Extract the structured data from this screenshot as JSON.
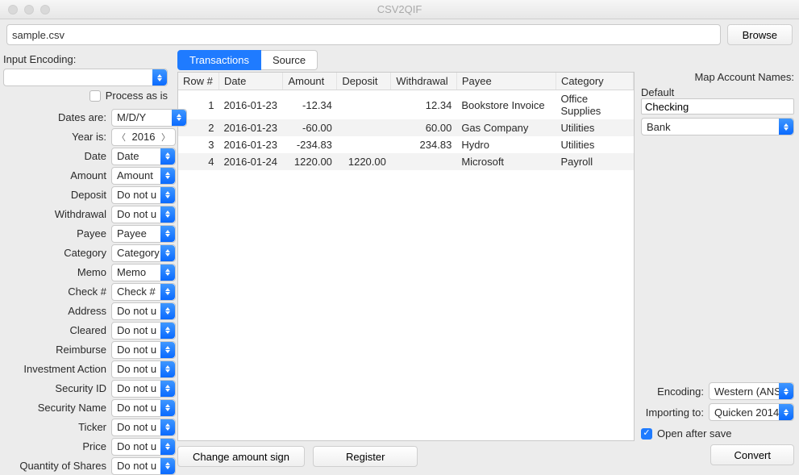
{
  "app": {
    "title": "CSV2QIF"
  },
  "header": {
    "file_value": "sample.csv",
    "browse_label": "Browse"
  },
  "left": {
    "input_encoding_label": "Input Encoding:",
    "input_encoding_value": "",
    "process_as_is_label": "Process as is",
    "dates_are_label": "Dates are:",
    "dates_are_value": "M/D/Y",
    "year_is_label": "Year is:",
    "year_value": "2016",
    "fields": [
      {
        "label": "Date",
        "value": "Date"
      },
      {
        "label": "Amount",
        "value": "Amount"
      },
      {
        "label": "Deposit",
        "value": "Do not u"
      },
      {
        "label": "Withdrawal",
        "value": "Do not u"
      },
      {
        "label": "Payee",
        "value": "Payee"
      },
      {
        "label": "Category",
        "value": "Category"
      },
      {
        "label": "Memo",
        "value": "Memo"
      },
      {
        "label": "Check #",
        "value": "Check #"
      },
      {
        "label": "Address",
        "value": "Do not u"
      },
      {
        "label": "Cleared",
        "value": "Do not u"
      },
      {
        "label": "Reimburse",
        "value": "Do not u"
      },
      {
        "label": "Investment Action",
        "value": "Do not u"
      },
      {
        "label": "Security ID",
        "value": "Do not u"
      },
      {
        "label": "Security Name",
        "value": "Do not u"
      },
      {
        "label": "Ticker",
        "value": "Do not u"
      },
      {
        "label": "Price",
        "value": "Do not u"
      },
      {
        "label": "Quantity of Shares",
        "value": "Do not u"
      }
    ]
  },
  "center": {
    "tabs": {
      "transactions": "Transactions",
      "source": "Source"
    },
    "columns": [
      "Row #",
      "Date",
      "Amount",
      "Deposit",
      "Withdrawal",
      "Payee",
      "Category"
    ],
    "rows": [
      {
        "row": "1",
        "date": "2016-01-23",
        "amount": "-12.34",
        "deposit": "",
        "withdrawal": "12.34",
        "payee": "Bookstore Invoice",
        "category": "Office Supplies"
      },
      {
        "row": "2",
        "date": "2016-01-23",
        "amount": "-60.00",
        "deposit": "",
        "withdrawal": "60.00",
        "payee": "Gas Company",
        "category": "Utilities"
      },
      {
        "row": "3",
        "date": "2016-01-23",
        "amount": "-234.83",
        "deposit": "",
        "withdrawal": "234.83",
        "payee": "Hydro",
        "category": "Utilities"
      },
      {
        "row": "4",
        "date": "2016-01-24",
        "amount": "1220.00",
        "deposit": "1220.00",
        "withdrawal": "",
        "payee": "Microsoft",
        "category": "Payroll"
      }
    ],
    "change_sign_label": "Change amount sign",
    "register_label": "Register"
  },
  "right": {
    "map_label": "Map Account Names:",
    "default_label": "Default",
    "account_name_value": "Checking",
    "account_type_value": "Bank",
    "encoding_label": "Encoding:",
    "encoding_value": "Western (ANS",
    "importing_label": "Importing to:",
    "importing_value": "Quicken 2014",
    "open_after_save_label": "Open after save",
    "convert_label": "Convert"
  }
}
